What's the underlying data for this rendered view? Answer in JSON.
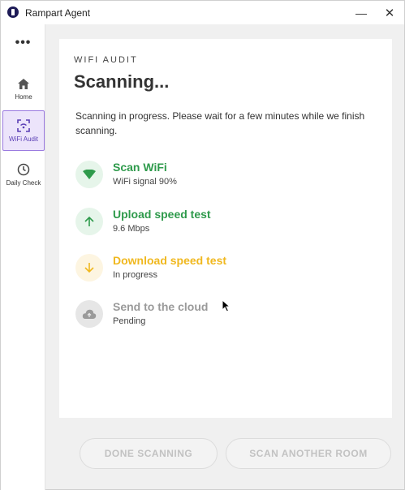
{
  "window": {
    "title": "Rampart Agent",
    "minimize_glyph": "—",
    "close_glyph": "✕"
  },
  "sidebar": {
    "more_glyph": "•••",
    "items": [
      {
        "label": "Home",
        "icon": "home-icon"
      },
      {
        "label": "WiFi Audit",
        "icon": "scan-icon",
        "active": true
      },
      {
        "label": "Daily Check",
        "icon": "clock-icon"
      }
    ]
  },
  "main": {
    "eyebrow": "WIFI AUDIT",
    "headline": "Scanning...",
    "description": "Scanning in progress. Please wait for a few minutes while we finish scanning.",
    "steps": [
      {
        "title": "Scan WiFi",
        "subtitle": "WiFi signal 90%",
        "status": "done",
        "icon": "wifi-icon"
      },
      {
        "title": "Upload speed test",
        "subtitle": "9.6 Mbps",
        "status": "done",
        "icon": "arrow-up-icon"
      },
      {
        "title": "Download speed test",
        "subtitle": "In progress",
        "status": "in-progress",
        "icon": "arrow-down-icon"
      },
      {
        "title": "Send to the cloud",
        "subtitle": "Pending",
        "status": "pending",
        "icon": "cloud-upload-icon"
      }
    ]
  },
  "actions": {
    "done_label": "DONE SCANNING",
    "another_label": "SCAN ANOTHER ROOM"
  },
  "colors": {
    "success": "#2e9a4b",
    "warning": "#f0b81f",
    "pending": "#9a9a9a",
    "accent": "#5b3fb5",
    "brand": "#1e1b57"
  }
}
